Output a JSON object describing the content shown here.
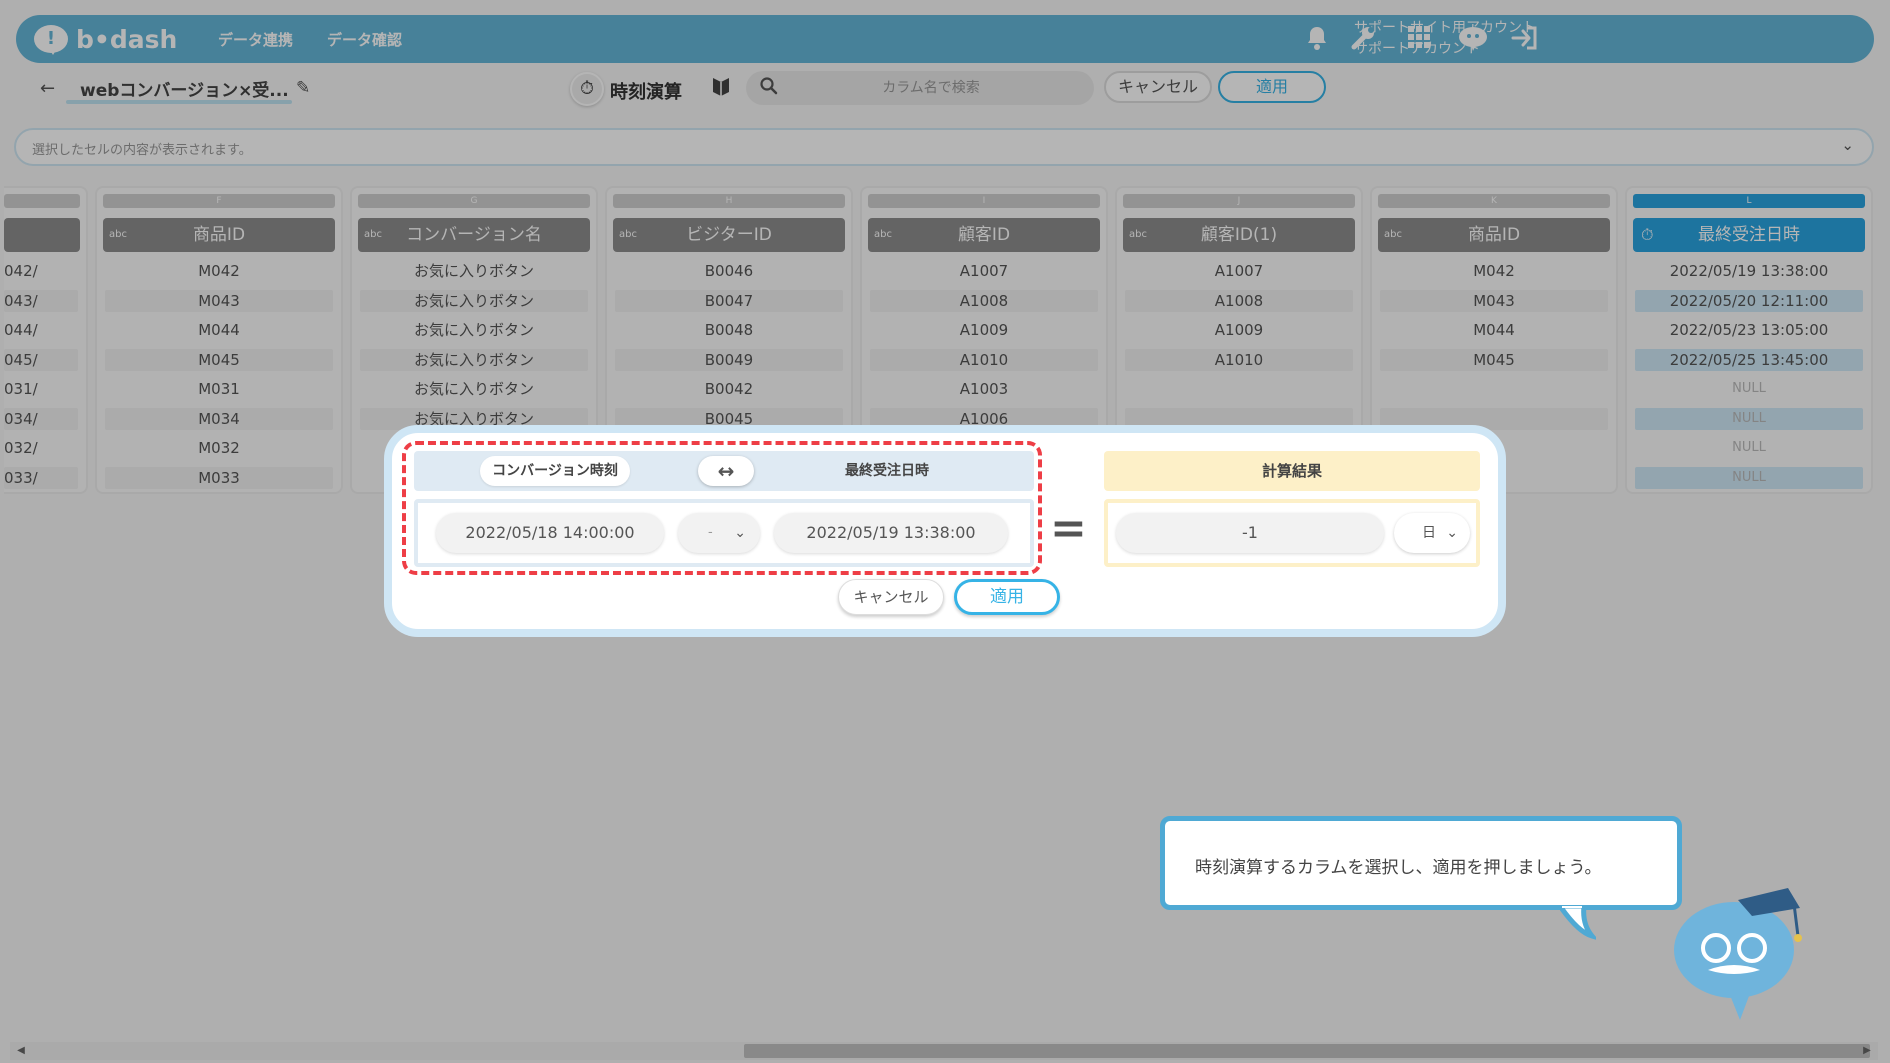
{
  "header": {
    "logo_text": "b•dash",
    "nav": [
      "データ連携",
      "データ確認"
    ],
    "account_line1": "サポートサイト用アカウント",
    "account_line2": "サポートアカウント",
    "icons": [
      "bell-icon",
      "wrench-icon",
      "apps-grid-icon",
      "mascot-chat-icon",
      "logout-icon"
    ]
  },
  "toolbar": {
    "title": "webコンバージョン×受...",
    "calc_mode": "時刻演算",
    "search_placeholder": "カラム名で検索",
    "cancel_label": "キャンセル",
    "apply_label": "適用"
  },
  "cell_display": {
    "placeholder": "選択したセルの内容が表示されます。"
  },
  "grid": {
    "partial_column_cells": [
      "042/",
      "043/",
      "044/",
      "045/",
      "031/",
      "034/",
      "032/",
      "033/"
    ],
    "columns": [
      {
        "letter": "F",
        "type": "abc",
        "name": "商品ID",
        "cells": [
          "M042",
          "M043",
          "M044",
          "M045",
          "M031",
          "M034",
          "M032",
          "M033"
        ]
      },
      {
        "letter": "G",
        "type": "abc",
        "name": "コンバージョン名",
        "cells": [
          "お気に入りボタン",
          "お気に入りボタン",
          "お気に入りボタン",
          "お気に入りボタン",
          "お気に入りボタン",
          "お気に入りボタン"
        ]
      },
      {
        "letter": "H",
        "type": "abc",
        "name": "ビジターID",
        "cells": [
          "B0046",
          "B0047",
          "B0048",
          "B0049",
          "B0042",
          "B0045"
        ]
      },
      {
        "letter": "I",
        "type": "abc",
        "name": "顧客ID",
        "cells": [
          "A1007",
          "A1008",
          "A1009",
          "A1010",
          "A1003",
          "A1006"
        ]
      },
      {
        "letter": "J",
        "type": "abc",
        "name": "顧客ID(1)",
        "cells": [
          "A1007",
          "A1008",
          "A1009",
          "A1010"
        ]
      },
      {
        "letter": "K",
        "type": "abc",
        "name": "商品ID",
        "cells": [
          "M042",
          "M043",
          "M044",
          "M045"
        ]
      },
      {
        "letter": "L",
        "type": "time",
        "name": "最終受注日時",
        "cells": [
          "2022/05/19 13:38:00",
          "2022/05/20 12:11:00",
          "2022/05/23 13:05:00",
          "2022/05/25 13:45:00",
          "NULL",
          "NULL",
          "NULL",
          "NULL"
        ]
      }
    ]
  },
  "dialog": {
    "left_label": "コンバージョン時刻",
    "swap_symbol": "↔",
    "right_label": "最終受注日時",
    "left_value": "2022/05/18 14:00:00",
    "operator_value": "-",
    "right_value": "2022/05/19 13:38:00",
    "equals_symbol": "=",
    "result_label": "計算結果",
    "result_value": "-1",
    "unit_value": "日",
    "cancel_label": "キャンセル",
    "apply_label": "適用"
  },
  "tutorial": {
    "text": "時刻演算するカラムを選択し、適用を押しましょう。"
  },
  "colors": {
    "brand": "#65b6d8",
    "accent": "#36b3e6",
    "highlight": "#ee3e46",
    "result": "#fdf0c8"
  }
}
